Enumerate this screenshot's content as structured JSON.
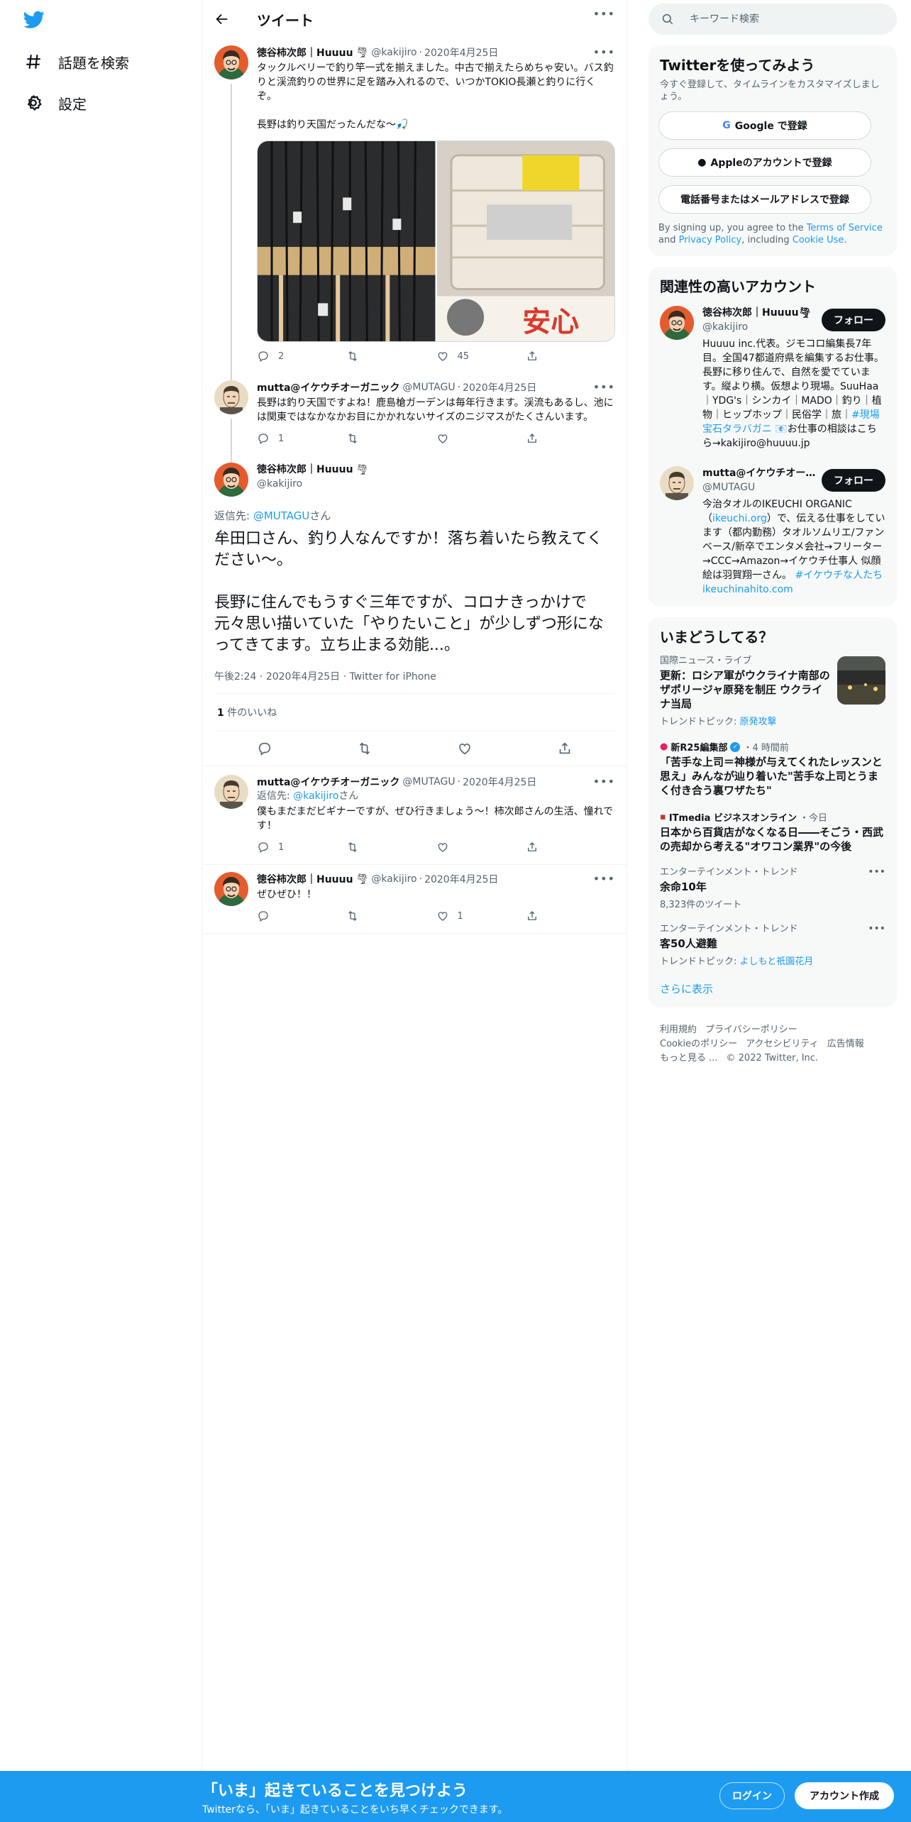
{
  "nav": {
    "explore_label": "話題を検索",
    "settings_label": "設定"
  },
  "header": {
    "title": "ツイート"
  },
  "tweets": {
    "t1": {
      "name": "徳谷柿次郎｜Huuuu",
      "handle": "@kakijiro",
      "date": "2020年4月25日",
      "text": "タックルベリーで釣り竿一式を揃えました。中古で揃えたらめちゃ安い。バス釣りと渓流釣りの世界に足を踏み入れるので、いつかTOKIO長瀬と釣りに行くぞ。\n\n長野は釣り天国だったんだな〜🎣",
      "replies": "2",
      "retweets": "",
      "likes": "45"
    },
    "t2": {
      "name": "mutta@イケウチオーガニック",
      "handle": "@MUTAGU",
      "date": "2020年4月25日",
      "text": "長野は釣り天国ですよね！鹿島槍ガーデンは毎年行きます。渓流もあるし、池には関東ではなかなかお目にかかれないサイズのニジマスがたくさんいます。",
      "replies": "1",
      "retweets": "",
      "likes": ""
    },
    "focused": {
      "name": "徳谷柿次郎｜Huuuu",
      "handle": "@kakijiro",
      "reply_prefix": "返信先: ",
      "reply_to": "@MUTAGU",
      "reply_suffix": "さん",
      "text": "牟田口さん、釣り人なんですか！落ち着いたら教えてください〜。\n\n長野に住んでもうすぐ三年ですが、コロナきっかけで元々思い描いていた「やりたいこと」が少しずつ形になってきてます。立ち止まる効能...。",
      "time": "午後2:24",
      "date": "2020年4月25日",
      "client": "Twitter for iPhone",
      "like_count": "1",
      "like_label": " 件のいいね"
    },
    "t3": {
      "name": "mutta@イケウチオーガニック",
      "handle": "@MUTAGU",
      "date": "2020年4月25日",
      "reply_prefix": "返信先: ",
      "reply_to": "@kakijiro",
      "reply_suffix": "さん",
      "text": "僕もまだまだビギナーですが、ぜひ行きましょう〜！柿次郎さんの生活、憧れです！",
      "replies": "1",
      "retweets": "",
      "likes": ""
    },
    "t4": {
      "name": "徳谷柿次郎｜Huuuu",
      "handle": "@kakijiro",
      "date": "2020年4月25日",
      "text": "ぜひぜひ！！",
      "replies": "",
      "retweets": "",
      "likes": "1"
    }
  },
  "search": {
    "placeholder": "キーワード検索"
  },
  "signup": {
    "title": "Twitterを使ってみよう",
    "subtitle": "今すぐ登録して、タイムラインをカスタマイズしましょう。",
    "google": "Google で登録",
    "apple": "Appleのアカウントで登録",
    "phone": "電話番号またはメールアドレスで登録",
    "terms_1": "By signing up, you agree to the ",
    "terms_link": "Terms of Service",
    "terms_2": " and ",
    "privacy_link": "Privacy Policy",
    "terms_3": ", including ",
    "cookie_link": "Cookie Use",
    "terms_4": "."
  },
  "who": {
    "title": "関連性の高いアカウント",
    "follow_label": "フォロー",
    "a1": {
      "name": "徳谷柿次郎｜Huuuu",
      "handle": "@kakijiro",
      "bio": "Huuuu inc.代表。ジモコロ編集長7年目。全国47都道府県を編集するお仕事。長野に移り住んで、自然を愛でています。縦より横。仮想より現場。SuuHaa｜YDG's｜シンカイ｜MADO｜釣り｜植物｜ヒップホップ｜民俗学｜旅｜",
      "hashtag": "#現場宝石タラバガニ",
      "bio_end": " 📧お仕事の相談はこちら→kakijiro@huuuu.jp"
    },
    "a2": {
      "name": "mutta@イケウチオーガニック",
      "handle": "@MUTAGU",
      "bio_1": "今治タオルのIKEUCHI ORGANIC（",
      "link": "ikeuchi.org",
      "bio_2": "）で、伝える仕事をしています（都内勤務）タオルソムリエ/ファンベース/新卒でエンタメ会社→フリーター→CCC→Amazon→イケウチ仕事人 似顔絵は羽賀翔一さん。",
      "hashtag": "#イケウチな人たち",
      "link2": "ikeuchinahito.com"
    }
  },
  "trends": {
    "title": "いまどうしてる？",
    "show_more": "さらに表示",
    "items": [
      {
        "category": "国際ニュース・ライブ",
        "title": "更新：ロシア軍がウクライナ南部のザポリージャ原発を制圧 ウクライナ当局",
        "topic_label": "トレンドトピック: ",
        "topic": "原発攻撃"
      },
      {
        "source": "新R25編集部",
        "time": "・4 時間前",
        "title": "「苦手な上司＝神様が与えてくれたレッスンと思え」みんなが辿り着いた\"苦手な上司とうまく付き合う裏ワザたち\""
      },
      {
        "source": "ITmedia ビジネスオンライン",
        "time": "・今日",
        "title": "日本から百貨店がなくなる日――そごう・西武の売却から考える\"オワコン業界\"の今後"
      },
      {
        "category": "エンターテインメント・トレンド",
        "title": "余命10年",
        "count": "8,323件のツイート"
      },
      {
        "category": "エンターテインメント・トレンド",
        "title": "客50人避難",
        "topic_label": "トレンドトピック: ",
        "topic": "よしもと祇園花月"
      }
    ]
  },
  "footer": {
    "terms": "利用規約",
    "privacy": "プライバシーポリシー",
    "cookie": "Cookieのポリシー",
    "accessibility": "アクセシビリティ",
    "ads": "広告情報",
    "more": "もっと見る ...",
    "copyright": "© 2022 Twitter, Inc."
  },
  "bottom_bar": {
    "title": "「いま」起きていることを見つけよう",
    "subtitle": "Twitterなら、「いま」起きていることをいち早くチェックできます。",
    "login": "ログイン",
    "signup": "アカウント作成"
  },
  "colors": {
    "accent": "#1d9bf0",
    "text": "#0f1419",
    "muted": "#536471",
    "border": "#eff3f4"
  }
}
